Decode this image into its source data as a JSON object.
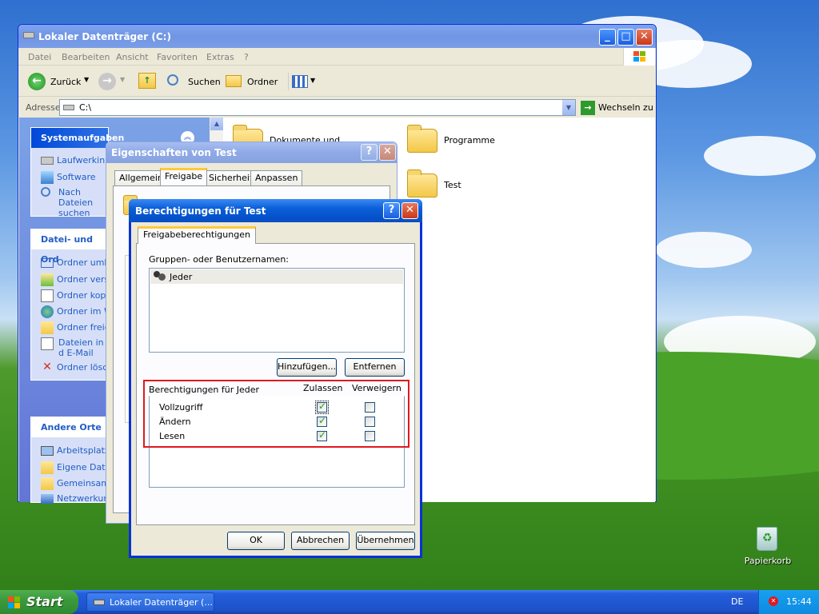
{
  "explorer": {
    "title": "Lokaler Datenträger (C:)",
    "menu": [
      "Datei",
      "Bearbeiten",
      "Ansicht",
      "Favoriten",
      "Extras",
      "?"
    ],
    "toolbar": {
      "back": "Zurück",
      "search": "Suchen",
      "folders": "Ordner"
    },
    "address_label": "Adresse",
    "address_value": "C:\\",
    "go_label": "Wechseln zu",
    "sidebar": {
      "system_tasks": {
        "title": "Systemaufgaben",
        "items": [
          "Laufwerkinh",
          "Software",
          "Nach Dateien suchen"
        ]
      },
      "file_tasks": {
        "title": "Datei- und Ord",
        "items": [
          "Ordner umbi",
          "Ordner vers",
          "Ordner kopi",
          "Ordner im W",
          "Ordner freig",
          "Dateien in d E-Mail sende",
          "Ordner lösch"
        ]
      },
      "other_places": {
        "title": "Andere Orte",
        "items": [
          "Arbeitsplatz",
          "Eigene Date",
          "Gemeinsame",
          "Netzwerkum"
        ]
      }
    },
    "folders": [
      "Dokumente und Einstellungen",
      "Programme",
      "Test"
    ]
  },
  "properties": {
    "title": "Eigenschaften von Test",
    "tabs": [
      "Allgemein",
      "Freigabe",
      "Sicherheit",
      "Anpassen"
    ],
    "active_tab": "Freigabe"
  },
  "permissions": {
    "title": "Berechtigungen für Test",
    "tab": "Freigabeberechtigungen",
    "groups_label": "Gruppen- oder Benutzernamen:",
    "users": [
      "Jeder"
    ],
    "add_button": "Hinzufügen...",
    "remove_button": "Entfernen",
    "perm_header": "Berechtigungen für Jeder",
    "allow_header": "Zulassen",
    "deny_header": "Verweigern",
    "rows": [
      {
        "name": "Vollzugriff",
        "allow": true,
        "deny": false
      },
      {
        "name": "Ändern",
        "allow": true,
        "deny": false
      },
      {
        "name": "Lesen",
        "allow": true,
        "deny": false
      }
    ],
    "ok": "OK",
    "cancel": "Abbrechen",
    "apply": "Übernehmen",
    "highlight_color": "#e0191f"
  },
  "desktop": {
    "recycle_bin": "Papierkorb"
  },
  "taskbar": {
    "start": "Start",
    "task": "Lokaler Datenträger (...",
    "language": "DE",
    "clock": "15:44"
  }
}
